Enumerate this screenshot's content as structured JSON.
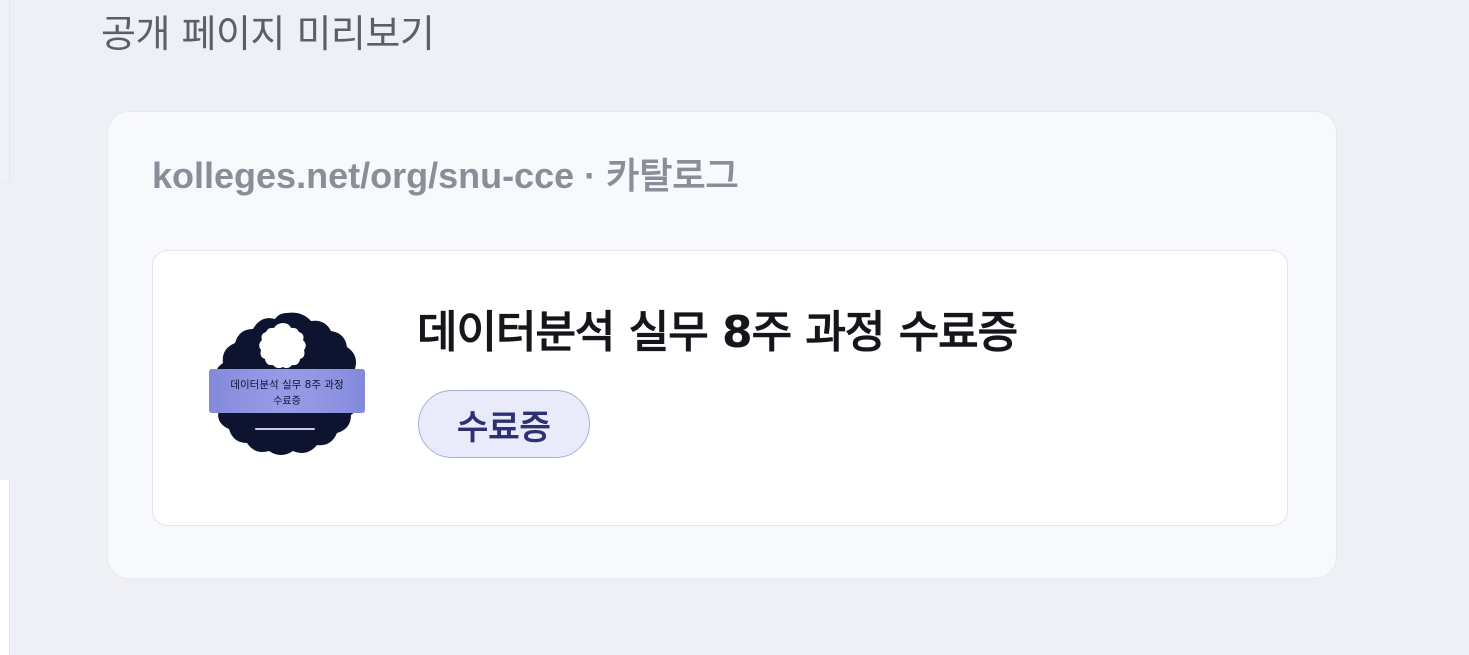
{
  "section": {
    "title": "공개 페이지 미리보기"
  },
  "preview": {
    "url_line": "kolleges.net/org/snu-cce · 카탈로그",
    "card": {
      "title": "데이터분석 실무 8주 과정 수료증",
      "tag": "수료증",
      "badge": {
        "line1": "데이터분석 실무 8주 과정",
        "line2": "수료증",
        "colors": {
          "outer": "#0e1430",
          "ribbon": "#8d93e0",
          "inner": "#ffffff"
        }
      }
    }
  }
}
